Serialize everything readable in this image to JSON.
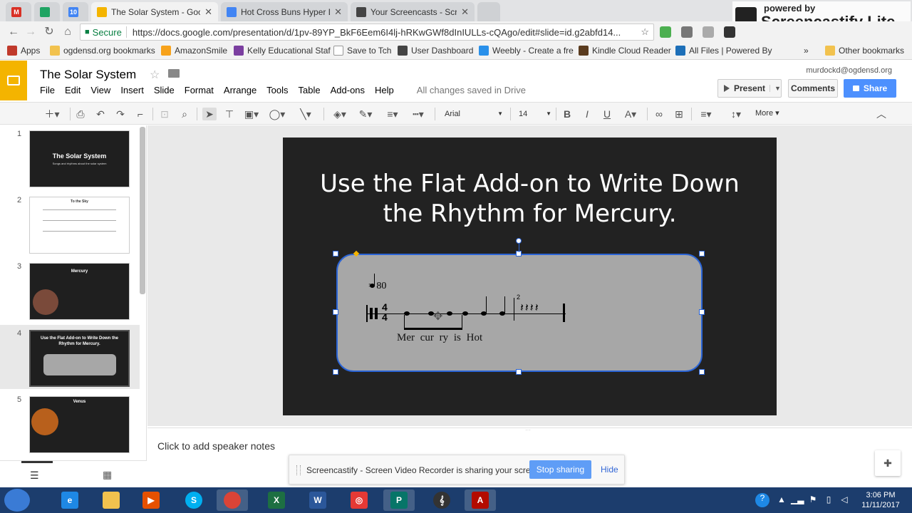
{
  "browser": {
    "tabs": [
      {
        "title": "",
        "icon": "gmail-icon",
        "color": "#d93025"
      },
      {
        "title": "",
        "icon": "drive-icon",
        "color": "#1fa463"
      },
      {
        "title": "10",
        "icon": "calendar-icon",
        "color": "#4285f4"
      },
      {
        "title": "The Solar System - Goog",
        "icon": "slides-icon",
        "color": "#f4b400",
        "active": true
      },
      {
        "title": "Hot Cross Buns Hyper Do",
        "icon": "docs-icon",
        "color": "#4285f4"
      },
      {
        "title": "Your Screencasts - Scree",
        "icon": "screencastify-icon",
        "color": "#444444"
      }
    ],
    "secure_label": "Secure",
    "url": "https://docs.google.com/presentation/d/1pv-89YP_BkF6Eem6I4lj-hRKwGWf8dInIULLs-cQAgo/edit#slide=id.g2abfd14...",
    "bookmarks": [
      {
        "label": "Apps",
        "icon": "apps-icon"
      },
      {
        "label": "ogdensd.org bookmarks",
        "icon": "folder-icon"
      },
      {
        "label": "AmazonSmile",
        "icon": "amazon-icon"
      },
      {
        "label": "Kelly Educational Staf",
        "icon": "kelly-icon"
      },
      {
        "label": "Save to Tch",
        "icon": "page-icon"
      },
      {
        "label": "User Dashboard",
        "icon": "dashboard-icon"
      },
      {
        "label": "Weebly - Create a fre",
        "icon": "weebly-icon"
      },
      {
        "label": "Kindle Cloud Reader",
        "icon": "kindle-icon"
      },
      {
        "label": "All Files | Powered By",
        "icon": "box-icon"
      }
    ],
    "other_bookmarks": "Other bookmarks",
    "overflow": "»"
  },
  "watermark": {
    "small": "powered by",
    "big": "Screencastify Lite"
  },
  "docs": {
    "title": "The Solar System",
    "user_email": "murdockd@ogdensd.org",
    "menu": [
      "File",
      "Edit",
      "View",
      "Insert",
      "Slide",
      "Format",
      "Arrange",
      "Tools",
      "Table",
      "Add-ons",
      "Help"
    ],
    "saved_status": "All changes saved in Drive",
    "present_label": "Present",
    "comments_label": "Comments",
    "share_label": "Share",
    "font": "Arial",
    "font_size": "14",
    "more_label": "More"
  },
  "filmstrip": {
    "slides": [
      {
        "num": "1",
        "title": "The Solar System",
        "subtitle": "Songs and rhythms about the solar system"
      },
      {
        "num": "2",
        "title": "To the Sky",
        "subtitle": ""
      },
      {
        "num": "3",
        "title": "Mercury",
        "subtitle": ""
      },
      {
        "num": "4",
        "title": "Use the Flat Add-on to Write Down the Rhythm for Mercury.",
        "subtitle": ""
      },
      {
        "num": "5",
        "title": "Venus",
        "subtitle": ""
      }
    ]
  },
  "slide": {
    "title_line1": "Use the Flat Add-on to Write Down",
    "title_line2": "the Rhythm for Mercury.",
    "tempo": "= 80",
    "bar_number": "2",
    "lyrics": "Mer cur ry is Hot",
    "time_signature_top": "4",
    "time_signature_bottom": "4"
  },
  "notes_placeholder": "Click to add speaker notes",
  "share_bar": {
    "message": "Screencastify - Screen Video Recorder is sharing your screen.",
    "stop_label": "Stop sharing",
    "hide_label": "Hide"
  },
  "taskbar": {
    "time": "3:06 PM",
    "date": "11/11/2017"
  }
}
